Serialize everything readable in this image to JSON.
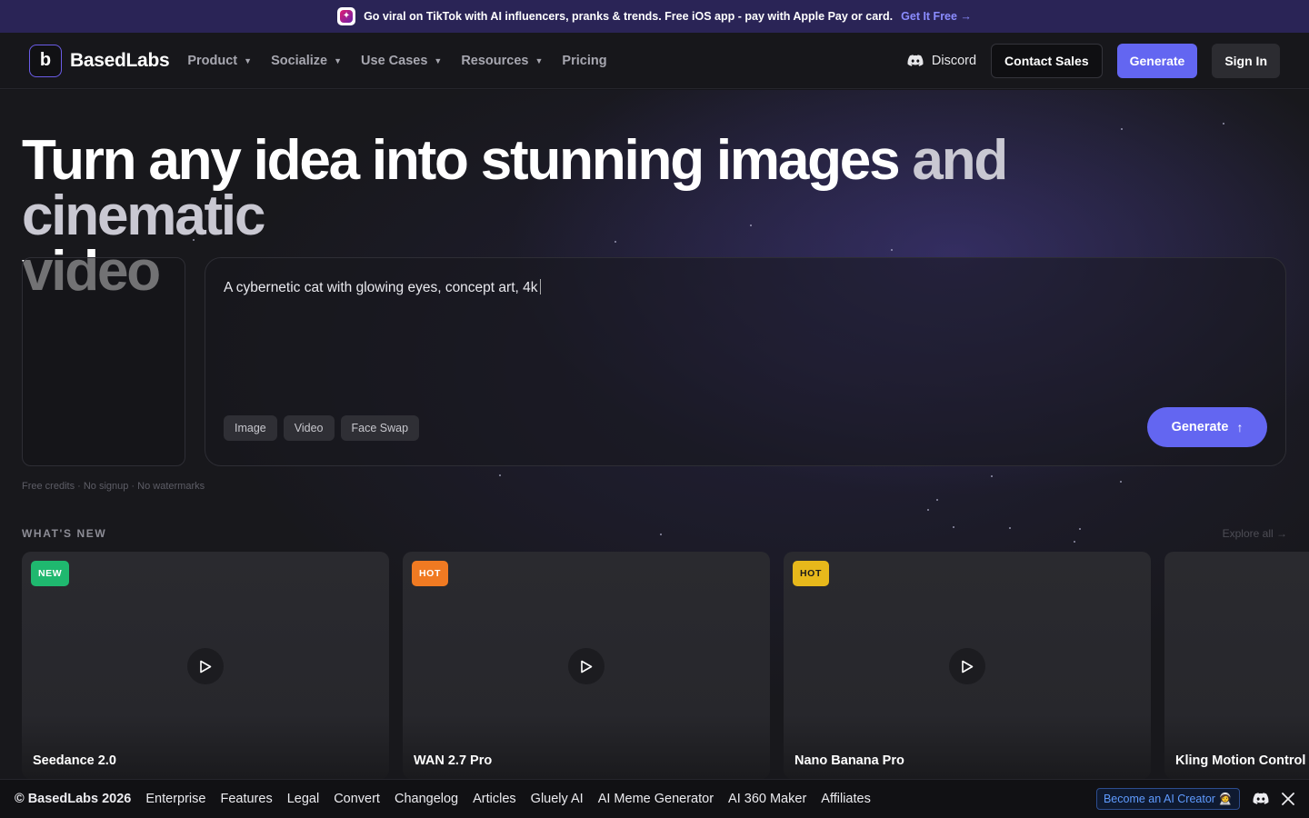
{
  "banner": {
    "icon": "tiktok-app-icon",
    "text": "Go viral on TikTok with AI influencers, pranks & trends. Free iOS app - pay with Apple Pay or card.",
    "cta": "Get It Free →"
  },
  "nav": {
    "logo_text": "BasedLabs",
    "links": [
      {
        "label": "Product",
        "dropdown": true
      },
      {
        "label": "Socialize",
        "dropdown": true
      },
      {
        "label": "Use Cases",
        "dropdown": true
      },
      {
        "label": "Resources",
        "dropdown": true
      },
      {
        "label": "Pricing",
        "dropdown": false
      }
    ],
    "discord_label": "Discord",
    "contact_label": "Contact Sales",
    "generate_label": "Generate",
    "signin_label": "Sign In"
  },
  "hero": {
    "headline_main": "Turn any idea into stunning images",
    "headline_dim": "and cinematic",
    "headline_end": "video",
    "prompt_text": "A cybernetic cat with glowing eyes, concept art, 4k",
    "chips": [
      "Image",
      "Video",
      "Face Swap"
    ],
    "generate_label": "Generate",
    "free_note": "Free credits · No signup · No watermarks"
  },
  "whats_new": {
    "label": "WHAT'S NEW",
    "explore": "Explore all →",
    "cards": [
      {
        "badge": "NEW",
        "title": "Seedance 2.0"
      },
      {
        "badge": "HOT",
        "title": "WAN 2.7 Pro"
      },
      {
        "badge": "HOT",
        "title": "Nano Banana Pro"
      },
      {
        "badge": "",
        "title": "Kling Motion Control"
      }
    ]
  },
  "footer": {
    "copyright": "© BasedLabs 2026",
    "links": [
      "Enterprise",
      "Features",
      "Legal",
      "Convert",
      "Changelog",
      "Articles",
      "Gluely AI",
      "AI Meme Generator",
      "AI 360 Maker",
      "Affiliates"
    ],
    "creator_label": "Become an AI Creator 🧑‍🚀"
  },
  "colors": {
    "accent": "#6366f1",
    "badge_new": "#1fb86f",
    "badge_hot": "#f07a22",
    "badge_hot_alt": "#e7b81b"
  }
}
